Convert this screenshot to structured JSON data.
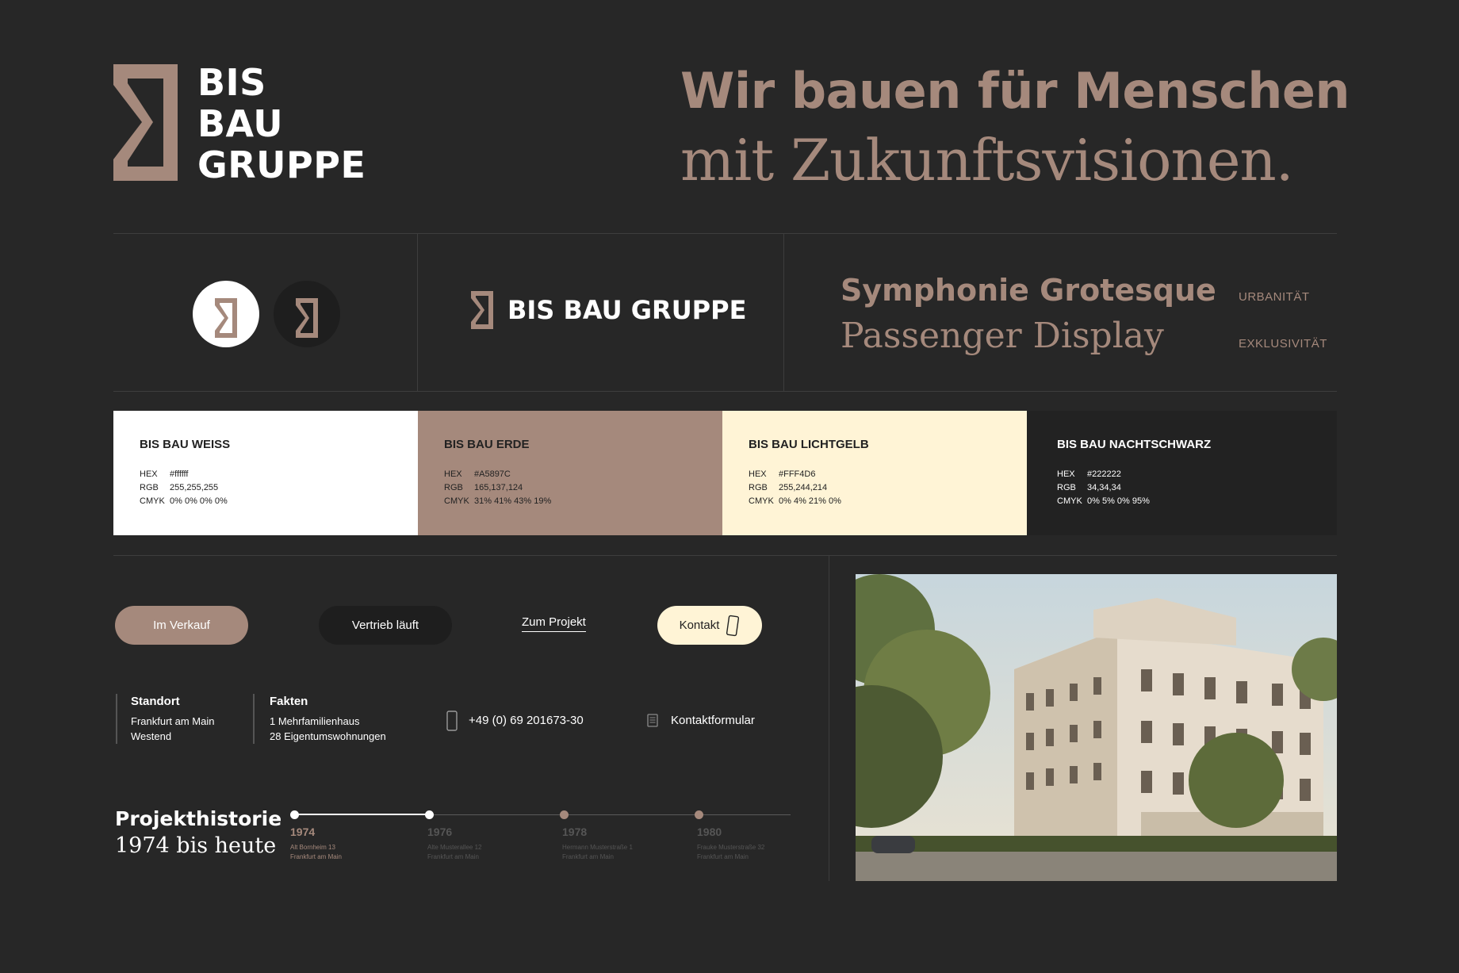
{
  "brand": {
    "logo_lines": [
      "BIS",
      "BAU",
      "GRUPPE"
    ],
    "wordmark": "BIS BAU GRUPPE"
  },
  "headline": {
    "line1": "Wir bauen für Menschen",
    "line2": "mit Zukunftsvisionen."
  },
  "typography": {
    "font_primary": "Symphonie Grotesque",
    "font_secondary": "Passenger Display",
    "tags": [
      "URBANITÄT",
      "EXKLUSIVITÄT"
    ]
  },
  "colors": [
    {
      "name": "BIS BAU WEISS",
      "hex": "#ffffff",
      "rgb": "255,255,255",
      "cmyk": "0% 0% 0% 0%",
      "swatch": "#ffffff",
      "text": "#222222"
    },
    {
      "name": "BIS BAU ERDE",
      "hex": "#A5897C",
      "rgb": "165,137,124",
      "cmyk": "31% 41% 43% 19%",
      "swatch": "#a5897c",
      "text": "#222222"
    },
    {
      "name": "BIS BAU LICHTGELB",
      "hex": "#FFF4D6",
      "rgb": "255,244,214",
      "cmyk": "0% 4% 21% 0%",
      "swatch": "#fff4d6",
      "text": "#222222"
    },
    {
      "name": "BIS BAU NACHTSCHWARZ",
      "hex": "#222222",
      "rgb": "34,34,34",
      "cmyk": "0% 5% 0% 95%",
      "swatch": "#222222",
      "text": "#ffffff"
    }
  ],
  "color_labels": {
    "hex": "HEX",
    "rgb": "RGB",
    "cmyk": "CMYK"
  },
  "buttons": {
    "in_sale": "Im Verkauf",
    "sales_running": "Vertrieb läuft",
    "to_project": "Zum Projekt",
    "contact": "Kontakt"
  },
  "info": {
    "location_title": "Standort",
    "location_lines": [
      "Frankfurt am Main",
      "Westend"
    ],
    "facts_title": "Fakten",
    "facts_lines": [
      "1 Mehrfamilienhaus",
      "28 Eigentumswohnungen"
    ],
    "phone": "+49 (0) 69 201673-30",
    "contact_form": "Kontaktformular"
  },
  "history": {
    "title": "Projekthistorie",
    "subtitle": "1974 bis heute",
    "entries": [
      {
        "year": "1974",
        "street": "Alt Bornheim 13",
        "city": "Frankfurt am Main"
      },
      {
        "year": "1976",
        "street": "Alte Musterallee 12",
        "city": "Frankfurt am Main"
      },
      {
        "year": "1978",
        "street": "Hermann Musterstraße 1",
        "city": "Frankfurt am Main"
      },
      {
        "year": "1980",
        "street": "Frauke Musterstraße 32",
        "city": "Frankfurt am Main"
      }
    ]
  },
  "palette": {
    "background": "#272727",
    "accent": "#a5897c",
    "light": "#fff4d6",
    "dark": "#222222"
  }
}
